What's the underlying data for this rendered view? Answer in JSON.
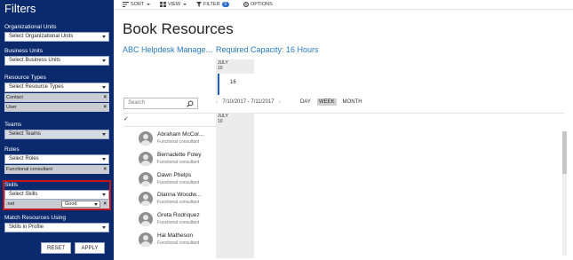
{
  "sidebar": {
    "title": "Filters",
    "groups": {
      "org_units": {
        "label": "Organizational Units",
        "placeholder": "Select Organizational Units"
      },
      "business_units": {
        "label": "Business Units",
        "placeholder": "Select Business Units"
      },
      "resource_types": {
        "label": "Resource Types",
        "placeholder": "Select Resource Types",
        "chips": [
          "Contact",
          "User"
        ]
      },
      "teams": {
        "label": "Teams",
        "placeholder": "Select Teams"
      },
      "roles": {
        "label": "Roles",
        "placeholder": "Select Roles",
        "chips": [
          "Functional consultant"
        ]
      },
      "skills": {
        "label": "Skills",
        "placeholder": "Select Skills",
        "skill_name": ".net",
        "rating": "Good"
      },
      "match": {
        "label": "Match Resources Using",
        "value": "Skills in Profile"
      }
    },
    "reset_label": "RESET",
    "apply_label": "APPLY",
    "remove_glyph": "×"
  },
  "toolbar": {
    "sort": "SORT",
    "view": "VIEW",
    "filter": "FILTER",
    "filter_count": "0",
    "options": "OPTIONS"
  },
  "main": {
    "title": "Book Resources",
    "requirement_name": "ABC Helpdesk Manage...",
    "required_capacity": "Required Capacity: 16 Hours",
    "summary_month": "JULY",
    "summary_day": "10",
    "summary_value": "16",
    "search_placeholder": "Search",
    "date_range": "7/10/2017 - 7/11/2017",
    "prev_arrow": "‹",
    "next_arrow": "›",
    "views": [
      "DAY",
      "WEEK",
      "MONTH"
    ],
    "active_view": "WEEK",
    "check_glyph": "✓",
    "grid_month": "JULY",
    "grid_day": "10"
  },
  "resources": [
    {
      "name": "Abraham McCor...",
      "role": "Functional consultant"
    },
    {
      "name": "Bernadette Foley",
      "role": "Functional consultant"
    },
    {
      "name": "Dawn Phelps",
      "role": "Functional consultant"
    },
    {
      "name": "Dianna Woodw...",
      "role": "Functional consultant"
    },
    {
      "name": "Greta Rodriquez",
      "role": "Functional consultant"
    },
    {
      "name": "Hal Matheson",
      "role": "Functional consultant"
    }
  ],
  "colors": {
    "sidebar_bg": "#0b2a6e",
    "accent": "#2a7abf",
    "highlight_border": "#c0161e"
  }
}
